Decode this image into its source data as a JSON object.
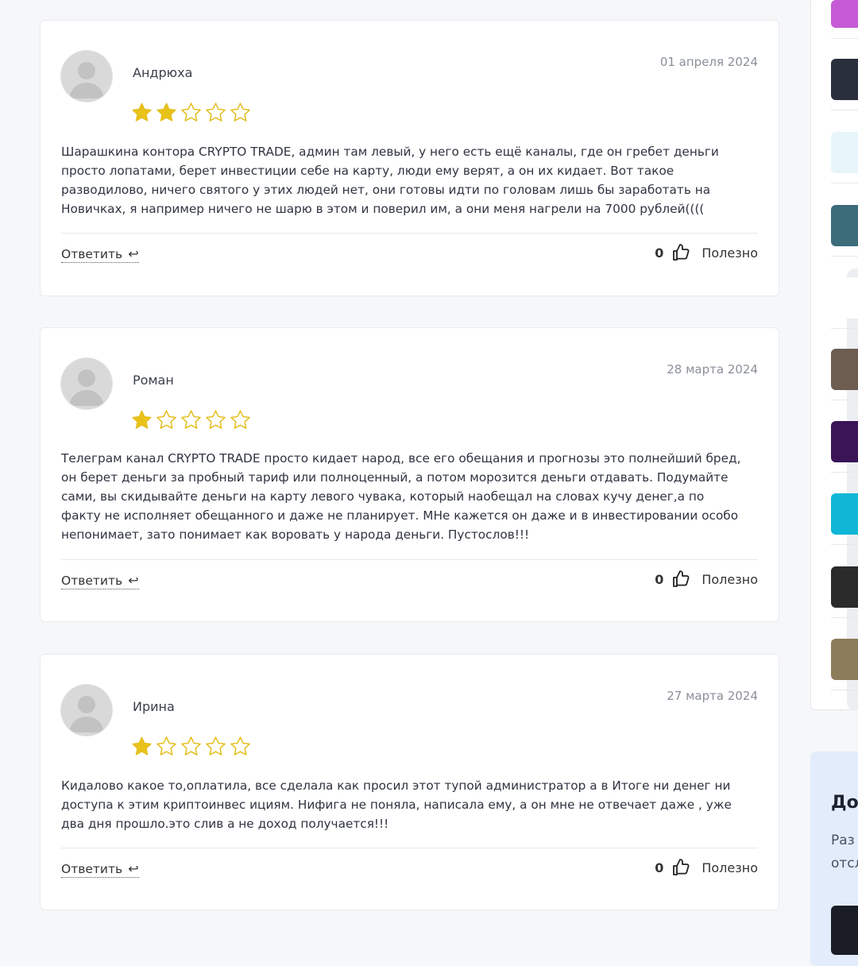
{
  "reviews": [
    {
      "author": "Андрюха",
      "date": "01 апреля 2024",
      "rating": 2,
      "text": "Шарашкина контора CRYPTO TRADE, админ там левый, у него есть ещё каналы, где он гребет деньги просто лопатами, берет инвестиции себе на карту, люди ему верят, а он их кидает. Вот такое разводилово, ничего святого у этих людей нет, они готовы идти по головам лишь бы заработать на Новичках, я например ничего не шарю в этом и поверил им, а они меня нагрели на 7000 рублей((((",
      "reply_label": "Ответить",
      "useful_count": "0",
      "useful_label": "Полезно"
    },
    {
      "author": "Роман",
      "date": "28 марта 2024",
      "rating": 1,
      "text": "Телеграм канал CRYPTO TRADE просто кидает народ, все его обещания и прогнозы это полнейший бред, он берет деньги за пробный тариф или полноценный, а потом морозится деньги отдавать. Подумайте сами, вы скидывайте деньги на карту левого чувака, который наобещал на словах кучу денег,а по факту не исполняет обещанного и даже не планирует. МНе кажется он даже и в инвестировании особо непонимает, зато понимает как воровать у народа деньги. Пустослов!!!",
      "reply_label": "Ответить",
      "useful_count": "0",
      "useful_label": "Полезно"
    },
    {
      "author": "Ирина",
      "date": "27 марта 2024",
      "rating": 1,
      "text": "Кидалово какое то,оплатила, все сделала как просил этот тупой администратор а в Итоге ни денег ни доступа к этим криптоинвес ициям. Нифига не поняла, написала ему, а он мне не отвечает даже , уже два дня прошло.это слив а не доход получается!!!",
      "reply_label": "Ответить",
      "useful_count": "0",
      "useful_label": "Полезно"
    }
  ],
  "colors": {
    "star": "#e9c21a",
    "star_outline": "#e3bd1a",
    "avatar_bg": "#d9d9d9",
    "avatar_fg": "#c2c2c2",
    "promo_bg": "#e3ecfb"
  },
  "icons": {
    "reply": "reply-arrow-icon",
    "useful": "thumbs-up-icon",
    "star_full": "star-filled-icon",
    "star_empty": "star-outline-icon",
    "avatar": "user-placeholder-icon"
  },
  "sidebar": {
    "items": [
      {
        "name": "channel-thumb-1",
        "color": "#c75ad6"
      },
      {
        "name": "channel-thumb-2",
        "color": "#2a2f3d"
      },
      {
        "name": "channel-thumb-3",
        "color": "#e8f6fb"
      },
      {
        "name": "channel-thumb-4",
        "color": "#3c6b7a"
      },
      {
        "name": "channel-thumb-5",
        "color": "#ffffff"
      },
      {
        "name": "channel-thumb-6",
        "color": "#6d5d50"
      },
      {
        "name": "channel-thumb-7",
        "color": "#3a1457"
      },
      {
        "name": "channel-thumb-8",
        "color": "#10b6d6"
      },
      {
        "name": "channel-thumb-9",
        "color": "#2b2b2b"
      },
      {
        "name": "channel-thumb-10",
        "color": "#8c7c5a"
      }
    ]
  },
  "promo": {
    "title": "До",
    "text_line1": "Раз",
    "text_line2": "отсл"
  }
}
